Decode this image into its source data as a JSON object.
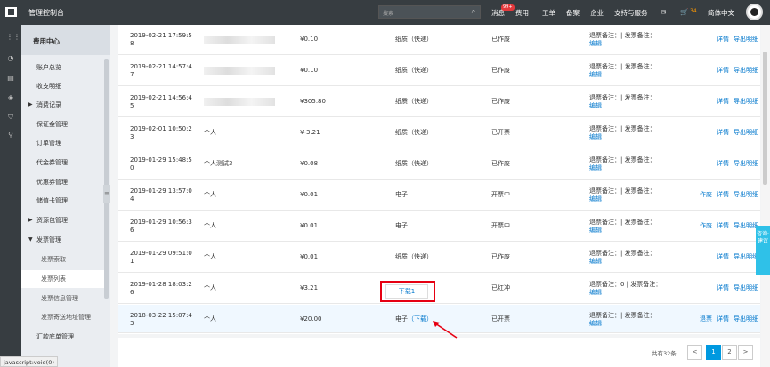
{
  "topbar": {
    "title": "管理控制台",
    "search_placeholder": "搜索",
    "nav": [
      "消息",
      "费用",
      "工单",
      "备案",
      "企业",
      "支持与服务",
      "简体中文"
    ],
    "message_badge": "99+",
    "cart_count": "34"
  },
  "menu": {
    "header": "费用中心",
    "items": [
      {
        "label": "账户总览"
      },
      {
        "label": "收支明细"
      },
      {
        "label": "消费记录",
        "arrow": "▶"
      },
      {
        "label": "保证金管理"
      },
      {
        "label": "订单管理"
      },
      {
        "label": "代金券管理"
      },
      {
        "label": "优惠券管理"
      },
      {
        "label": "储值卡管理"
      },
      {
        "label": "资源包管理",
        "arrow": "▶"
      },
      {
        "label": "发票管理",
        "arrow": "▼"
      },
      {
        "label": "发票索取"
      },
      {
        "label": "发票列表"
      },
      {
        "label": "发票信息管理"
      },
      {
        "label": "发票寄送地址管理"
      },
      {
        "label": "汇款底单管理"
      }
    ]
  },
  "rows": [
    {
      "time": "2019-02-21 17:59:58",
      "name": "",
      "amount": "¥0.10",
      "type": "纸质（快递）",
      "status": "已作废",
      "remark": "退票备注：| 发票备注：",
      "edit": "编辑",
      "actions": [
        "详情",
        "导出明细"
      ]
    },
    {
      "time": "2019-02-21 14:57:47",
      "name": "",
      "amount": "¥0.10",
      "type": "纸质（快递）",
      "status": "已作废",
      "remark": "退票备注：| 发票备注：",
      "edit": "编辑",
      "actions": [
        "详情",
        "导出明细"
      ]
    },
    {
      "time": "2019-02-21 14:56:45",
      "name": "",
      "amount": "¥305.80",
      "type": "纸质（快递）",
      "status": "已作废",
      "remark": "退票备注：| 发票备注：",
      "edit": "编辑",
      "actions": [
        "详情",
        "导出明细"
      ]
    },
    {
      "time": "2019-02-01 10:50:23",
      "name": "个人",
      "amount": "¥-3.21",
      "type": "纸质（快递）",
      "status": "已开票",
      "remark": "退票备注：| 发票备注：",
      "edit": "编辑",
      "actions": [
        "详情",
        "导出明细"
      ]
    },
    {
      "time": "2019-01-29 15:48:50",
      "name": "个人测试3",
      "amount": "¥0.08",
      "type": "纸质（快递）",
      "status": "已作废",
      "remark": "退票备注：| 发票备注：",
      "edit": "编辑",
      "actions": [
        "详情",
        "导出明细"
      ]
    },
    {
      "time": "2019-01-29 13:57:04",
      "name": "个人",
      "amount": "¥0.01",
      "type": "电子",
      "status": "开票中",
      "remark": "退票备注：| 发票备注：",
      "edit": "编辑",
      "actions": [
        "作废",
        "详情",
        "导出明细"
      ]
    },
    {
      "time": "2019-01-29 10:56:36",
      "name": "个人",
      "amount": "¥0.01",
      "type": "电子",
      "status": "开票中",
      "remark": "退票备注：| 发票备注：",
      "edit": "编辑",
      "actions": [
        "作废",
        "详情",
        "导出明细"
      ]
    },
    {
      "time": "2019-01-29 09:51:01",
      "name": "个人",
      "amount": "¥0.01",
      "type": "纸质（快递）",
      "status": "已作废",
      "remark": "退票备注：| 发票备注：",
      "edit": "编辑",
      "actions": [
        "详情",
        "导出明细"
      ]
    },
    {
      "time": "2019-01-28 18:03:26",
      "name": "个人",
      "amount": "¥3.21",
      "type": "",
      "status": "已红冲",
      "remark": "退票备注：0 | 发票备注：",
      "edit": "编辑",
      "actions": [
        "详情",
        "导出明细"
      ]
    },
    {
      "time": "2018-03-22 15:07:43",
      "name": "个人",
      "amount": "¥20.00",
      "type": "电子",
      "type_link": "（下载）",
      "status": "已开票",
      "remark": "退票备注：| 发票备注：",
      "edit": "编辑",
      "actions": [
        "退票",
        "详情",
        "导出明细"
      ]
    }
  ],
  "popup": {
    "label": "下载1"
  },
  "pager": {
    "total": "共有32条",
    "prev": "<",
    "pages": [
      "1",
      "2"
    ],
    "next": ">"
  },
  "help": {
    "label": "咨询·建议"
  },
  "status_url": "javascript:void(0)"
}
